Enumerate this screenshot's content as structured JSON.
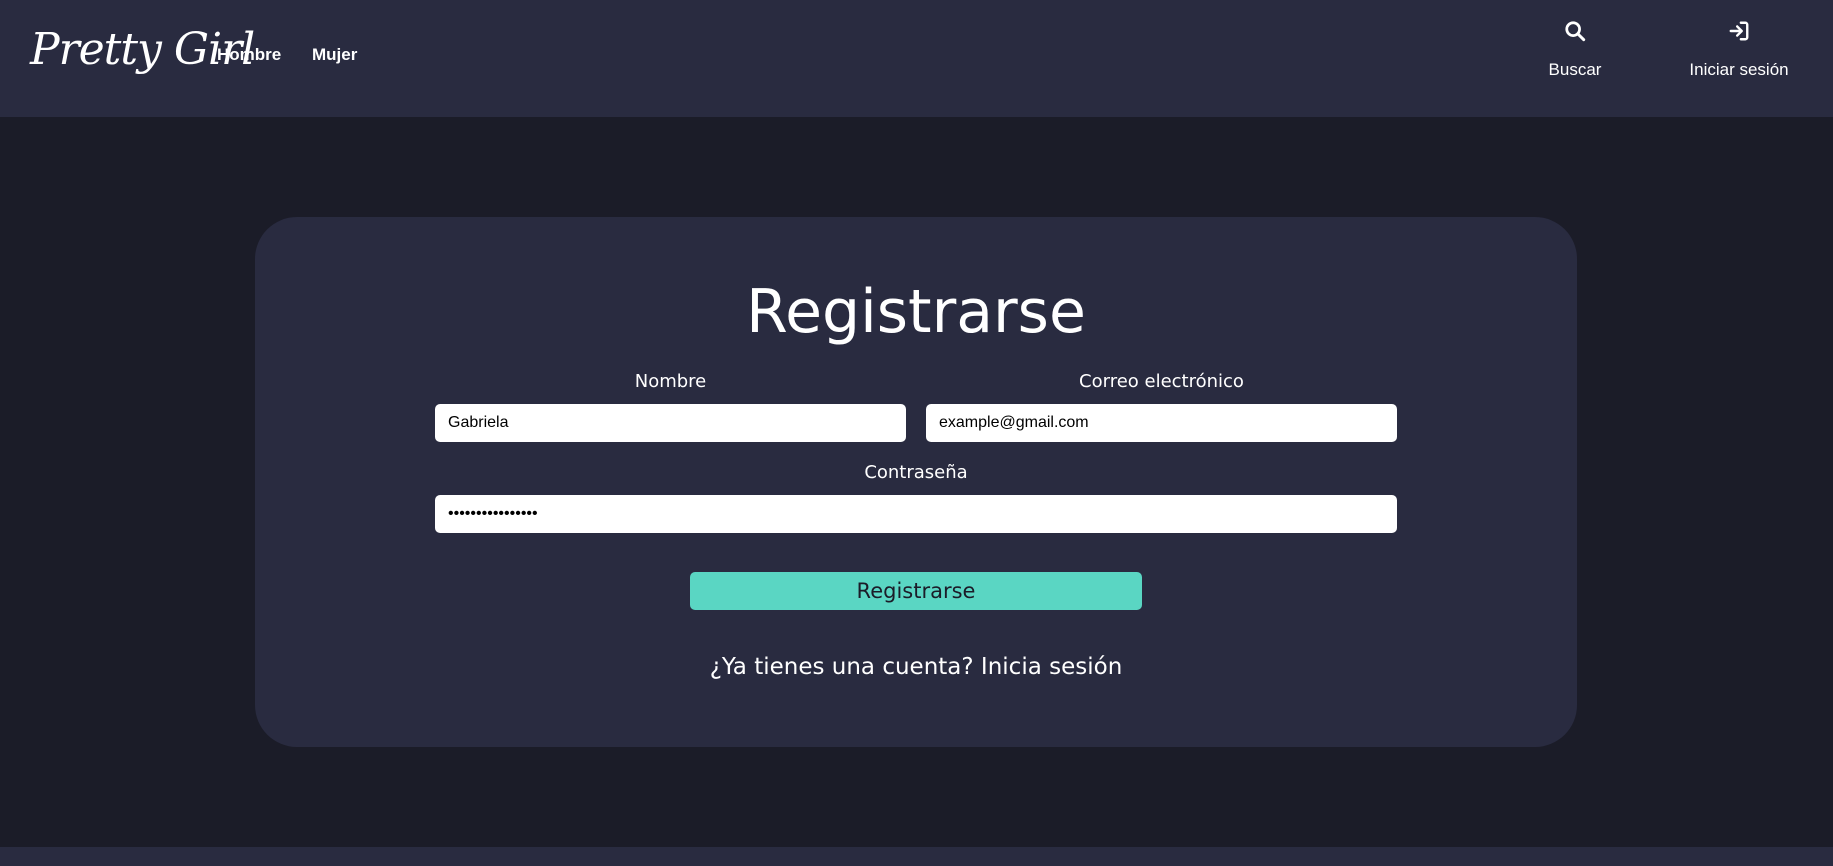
{
  "brand": {
    "logo_text": "Pretty Girl"
  },
  "nav": {
    "links": [
      {
        "label": "Hombre"
      },
      {
        "label": "Mujer"
      }
    ],
    "actions": [
      {
        "label": "Buscar",
        "icon": "search-icon"
      },
      {
        "label": "Iniciar sesión",
        "icon": "sign-in-icon"
      }
    ]
  },
  "form": {
    "title": "Registrarse",
    "name": {
      "label": "Nombre",
      "value": "Gabriela"
    },
    "email": {
      "label": "Correo electrónico",
      "value": "example@gmail.com"
    },
    "password": {
      "label": "Contraseña",
      "value": "••••••••••••••••"
    },
    "submit_label": "Registrarse",
    "signin_prompt": "¿Ya tienes una cuenta?",
    "signin_link": "Inicia sesión"
  },
  "colors": {
    "navbar_bg": "#292b40",
    "page_bg": "#1b1c28",
    "card_bg": "#292b40",
    "accent": "#5ad6c3"
  }
}
